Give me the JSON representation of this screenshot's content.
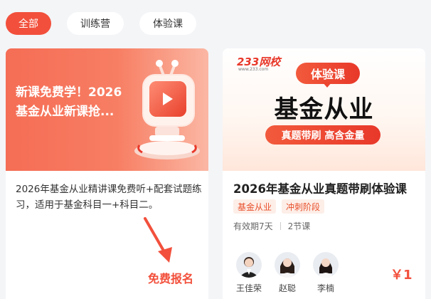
{
  "tabs": [
    {
      "label": "全部",
      "active": true
    },
    {
      "label": "训练营",
      "active": false
    },
    {
      "label": "体验课",
      "active": false
    }
  ],
  "left_card": {
    "banner_title": "新课免费学！2026基金从业新课抢...",
    "description": "2026年基金从业精讲课免费听+配套试题练习，适用于基金科目一+科目二。",
    "action_label": "免费报名"
  },
  "right_card": {
    "logo_text": "233网校",
    "logo_sub": "www.233.com",
    "banner_pill": "体验课",
    "banner_big": "基金从业",
    "banner_sub": "真题带刷 高含金量",
    "title": "2026年基金从业真题带刷体验课",
    "tags": [
      "基金从业",
      "冲刺阶段"
    ],
    "validity": "有效期7天",
    "lessons": "2节课",
    "teachers": [
      {
        "name": "王佳荣"
      },
      {
        "name": "赵聪"
      },
      {
        "name": "李楠"
      }
    ],
    "price": "￥1"
  },
  "colors": {
    "accent": "#f2503c",
    "tag_bg": "#fdeee8"
  }
}
